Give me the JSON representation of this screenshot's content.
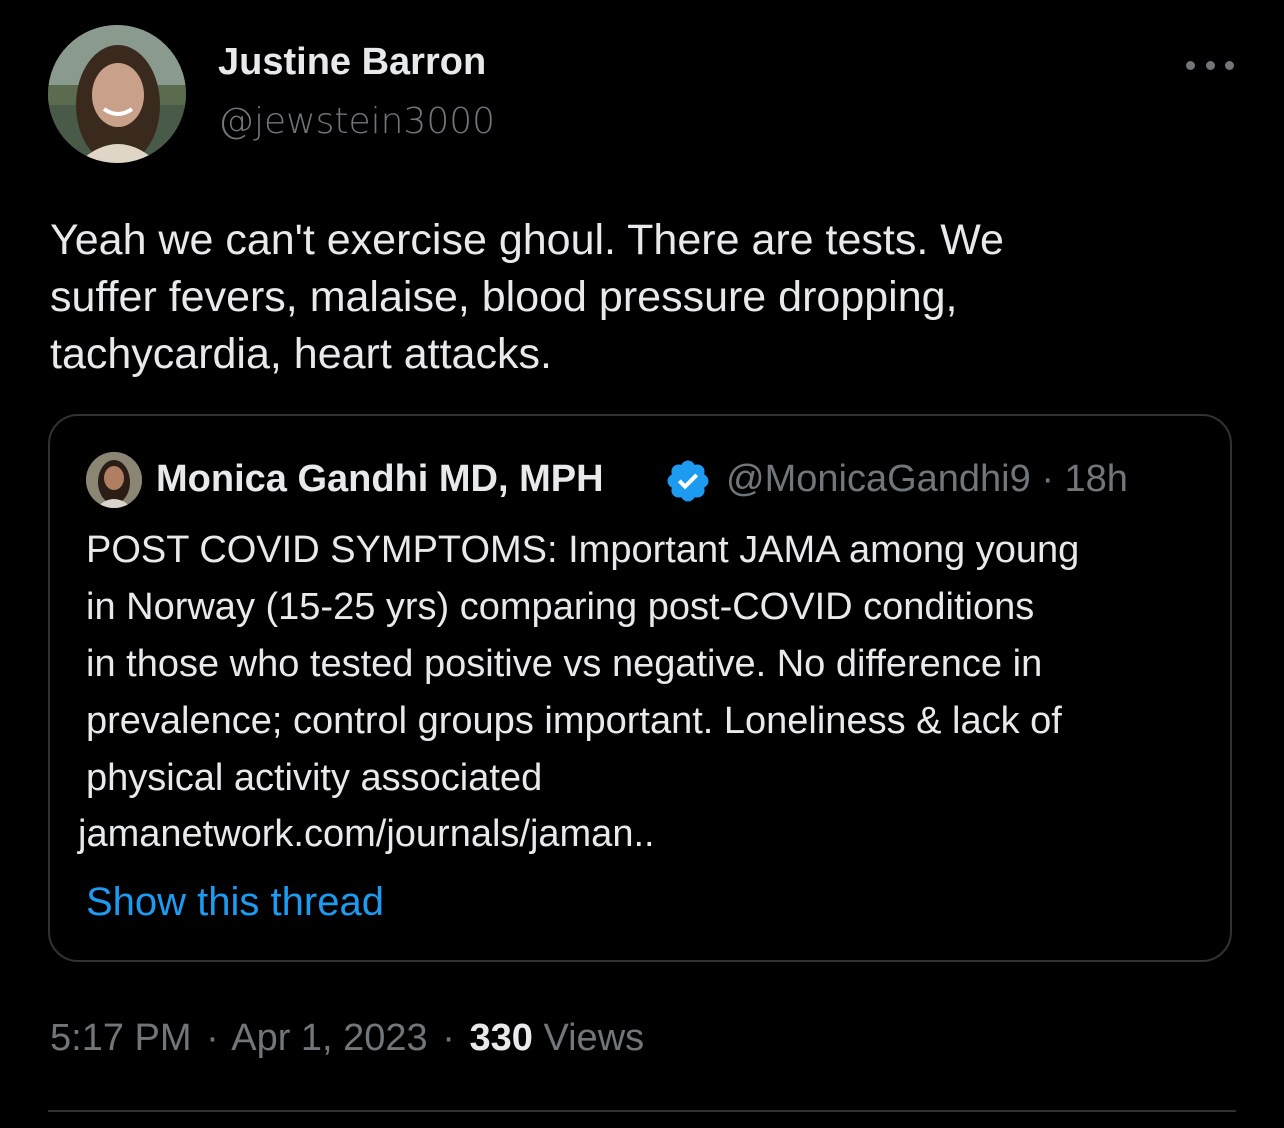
{
  "colors": {
    "background": "#000000",
    "text": "#e7e9ea",
    "secondary": "#71767b",
    "link": "#1d9bf0",
    "border": "#2f3336",
    "verified": "#1d9bf0"
  },
  "tweet": {
    "author_name": "Justine Barron",
    "author_handle": "@jewstein3000",
    "text": "Yeah we can't exercise ghoul. There are tests. We\nsuffer fevers, malaise, blood pressure dropping,\ntachycardia, heart attacks.",
    "more_icon": "more-horizontal-icon"
  },
  "quote": {
    "author_name": "Monica Gandhi MD, MPH",
    "verified_icon": "verified-badge-icon",
    "author_handle": "@MonicaGandhi9",
    "dot": "·",
    "time": "18h",
    "text": "POST COVID SYMPTOMS: Important JAMA among young\nin Norway (15-25 yrs) comparing post-COVID conditions\nin those who tested positive vs negative. No difference in\nprevalence; control groups important. Loneliness & lack of\nphysical activity associated",
    "link": "jamanetwork.com/journals/jaman..",
    "show_thread": "Show this thread"
  },
  "meta": {
    "time": "5:17 PM",
    "dot": "·",
    "date": "Apr 1, 2023",
    "views_count": "330",
    "views_label": "Views"
  }
}
